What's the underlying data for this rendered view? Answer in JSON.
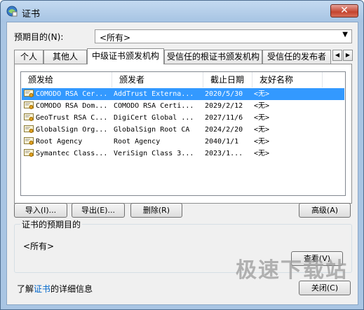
{
  "window": {
    "title": "证书",
    "close_label": "✕"
  },
  "purpose": {
    "label": "预期目的(N):",
    "selected": "<所有>"
  },
  "tabs": [
    {
      "label": "个人"
    },
    {
      "label": "其他人"
    },
    {
      "label": "中级证书颁发机构"
    },
    {
      "label": "受信任的根证书颁发机构"
    },
    {
      "label": "受信任的发布者"
    }
  ],
  "tab_scroll": {
    "left": "◀",
    "right": "▶"
  },
  "list": {
    "columns": [
      "颁发给",
      "颁发者",
      "截止日期",
      "友好名称"
    ],
    "rows": [
      {
        "issued_to": "COMODO RSA Cer...",
        "issued_by": "AddTrust Externa...",
        "expiry": "2020/5/30",
        "friendly": "<无>",
        "selected": true
      },
      {
        "issued_to": "COMODO RSA Dom...",
        "issued_by": "COMODO RSA Certi...",
        "expiry": "2029/2/12",
        "friendly": "<无>"
      },
      {
        "issued_to": "GeoTrust RSA C...",
        "issued_by": "DigiCert Global ...",
        "expiry": "2027/11/6",
        "friendly": "<无>"
      },
      {
        "issued_to": "GlobalSign Org...",
        "issued_by": "GlobalSign Root CA",
        "expiry": "2024/2/20",
        "friendly": "<无>"
      },
      {
        "issued_to": "Root Agency",
        "issued_by": "Root Agency",
        "expiry": "2040/1/1",
        "friendly": "<无>"
      },
      {
        "issued_to": "Symantec Class...",
        "issued_by": "VeriSign Class 3...",
        "expiry": "2023/1...",
        "friendly": "<无>"
      }
    ]
  },
  "buttons": {
    "import": "导入(I)...",
    "export": "导出(E)...",
    "remove": "删除(R)",
    "advanced": "高级(A)",
    "view": "查看(V)",
    "close": "关闭(C)"
  },
  "purposes_group": {
    "label": "证书的预期目的",
    "value": "<所有>"
  },
  "footer": {
    "prefix": "了解",
    "link": "证书",
    "suffix": "的详细信息"
  },
  "watermark": "极速下载站",
  "colors": {
    "selection": "#3399ff",
    "link": "#0066cc",
    "title_bar": "#a9c5e3"
  }
}
